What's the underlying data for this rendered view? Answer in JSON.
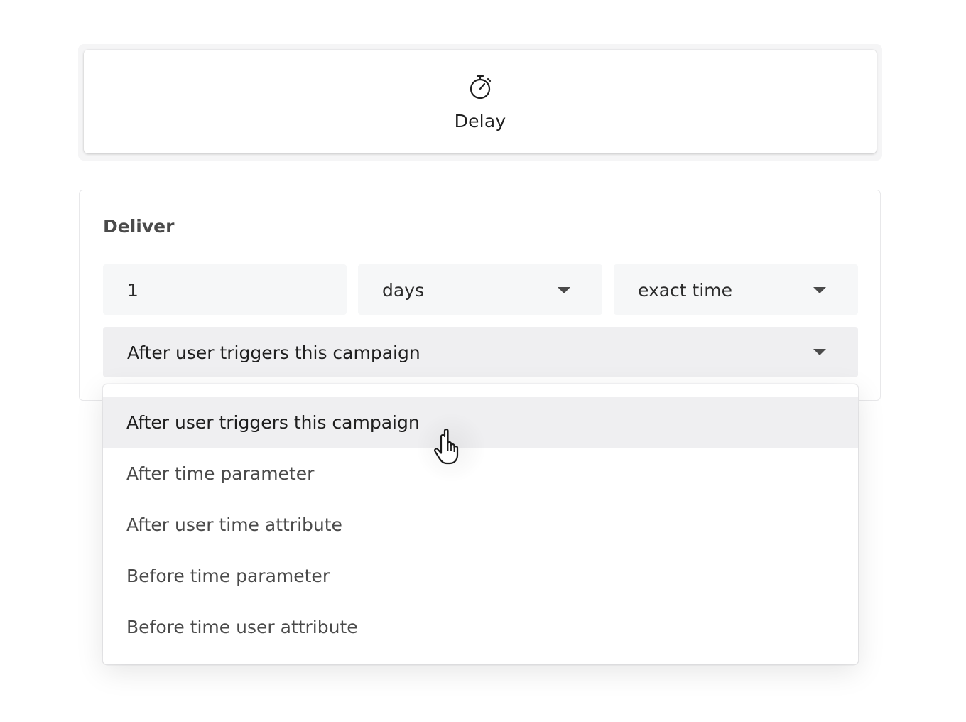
{
  "delay_card": {
    "icon": "stopwatch-icon",
    "label": "Delay"
  },
  "deliver": {
    "title": "Deliver",
    "amount_value": "1",
    "unit_select": {
      "selected": "days"
    },
    "timing_select": {
      "selected": "exact time"
    },
    "trigger_select": {
      "selected": "After user triggers this campaign"
    }
  },
  "trigger_menu": {
    "highlighted_index": 0,
    "options": [
      {
        "label": "After user triggers this campaign"
      },
      {
        "label": "After time parameter"
      },
      {
        "label": "After user time attribute"
      },
      {
        "label": "Before time parameter"
      },
      {
        "label": "Before time user attribute"
      }
    ]
  },
  "cursor": {
    "icon": "hand-pointer-icon"
  }
}
